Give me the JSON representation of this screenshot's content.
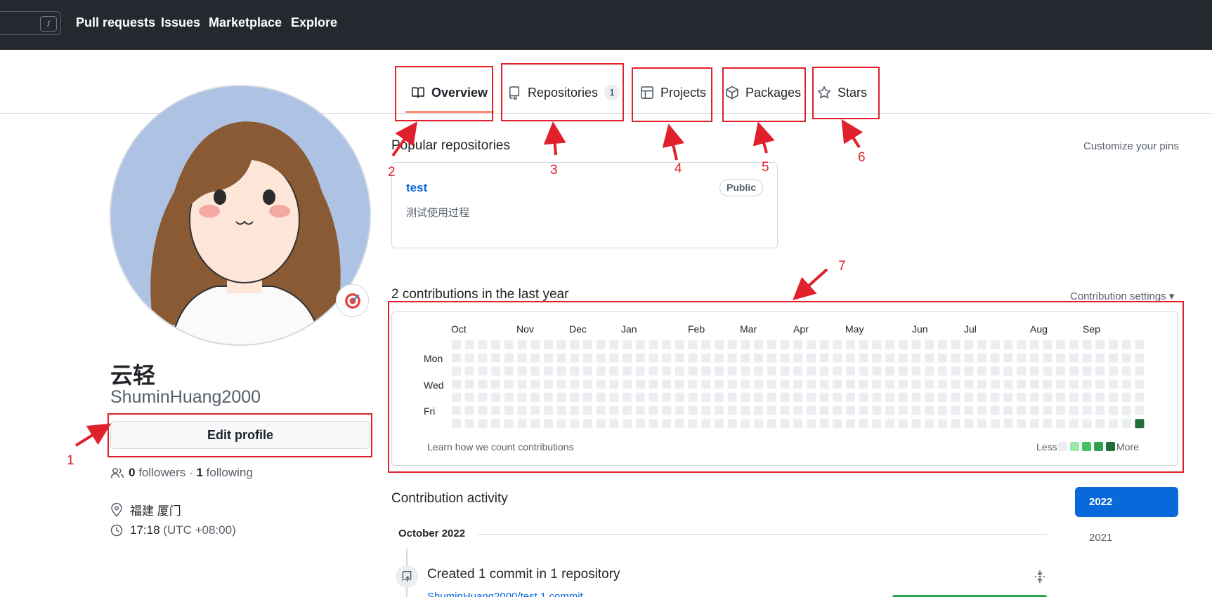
{
  "header": {
    "search_shortcut": "/",
    "nav": [
      "Pull requests",
      "Issues",
      "Marketplace",
      "Explore"
    ]
  },
  "tabs": {
    "overview": "Overview",
    "repositories": "Repositories",
    "repositories_count": "1",
    "projects": "Projects",
    "packages": "Packages",
    "stars": "Stars"
  },
  "profile": {
    "display_name": "云轻",
    "username": "ShuminHuang2000",
    "edit_button": "Edit profile",
    "followers_count": "0",
    "followers_label": "followers",
    "separator": "·",
    "following_count": "1",
    "following_label": "following",
    "location": "福建 厦门",
    "local_time": "17:18",
    "timezone": "(UTC +08:00)"
  },
  "popular": {
    "title": "Popular repositories",
    "customize": "Customize your pins",
    "repo": {
      "name": "test",
      "visibility": "Public",
      "description": "测试使用过程"
    }
  },
  "contributions": {
    "title": "2 contributions in the last year",
    "settings": "Contribution settings ▾",
    "months": [
      "Oct",
      "Nov",
      "Dec",
      "Jan",
      "Feb",
      "Mar",
      "Apr",
      "May",
      "Jun",
      "Jul",
      "Aug",
      "Sep"
    ],
    "days": [
      "Mon",
      "Wed",
      "Fri"
    ],
    "learn": "Learn how we count contributions",
    "less": "Less",
    "more": "More",
    "colors": {
      "empty": "#ebedf0",
      "l1": "#9be9a8",
      "l2": "#40c463",
      "l3": "#30a14e",
      "l4": "#216e39"
    }
  },
  "activity": {
    "title": "Contribution activity",
    "years": [
      "2022",
      "2021"
    ],
    "month_heading": "October 2022",
    "commit_summary": "Created 1 commit in 1 repository",
    "repo_link": "ShuminHuang2000/test  1 commit"
  },
  "annotations": [
    "1",
    "2",
    "3",
    "4",
    "5",
    "6",
    "7"
  ],
  "colors": {
    "annotation": "#e0202a",
    "header_bg": "#24292f",
    "link": "#0969da",
    "tab_underline": "#fd8c73"
  }
}
